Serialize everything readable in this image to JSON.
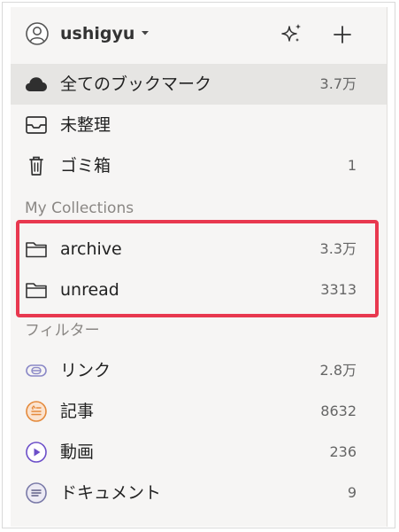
{
  "header": {
    "username": "ushigyu"
  },
  "main_items": [
    {
      "label": "全てのブックマーク",
      "count": "3.7万"
    },
    {
      "label": "未整理",
      "count": ""
    },
    {
      "label": "ゴミ箱",
      "count": "1"
    }
  ],
  "collections": {
    "title": "My Collections",
    "items": [
      {
        "label": "archive",
        "count": "3.3万"
      },
      {
        "label": "unread",
        "count": "3313"
      }
    ]
  },
  "filters": {
    "title": "フィルター",
    "items": [
      {
        "label": "リンク",
        "count": "2.8万"
      },
      {
        "label": "記事",
        "count": "8632"
      },
      {
        "label": "動画",
        "count": "236"
      },
      {
        "label": "ドキュメント",
        "count": "9"
      }
    ]
  },
  "colors": {
    "highlight": "#e8384f",
    "selected_row": "#e6e5e3",
    "link_icon": "#8b89c7",
    "article_icon": "#e48a3c",
    "video_icon": "#6c4fc9",
    "document_icon": "#7a7aa8"
  },
  "icons": {
    "avatar": "user-avatar-icon",
    "dropdown": "caret-down-icon",
    "ai": "sparkle-icon",
    "add": "plus-icon",
    "all": "cloud-icon",
    "unsorted": "inbox-icon",
    "trash": "trash-icon",
    "folder": "folder-icon",
    "link": "link-icon",
    "article": "article-icon",
    "video": "play-icon",
    "document": "document-icon"
  }
}
